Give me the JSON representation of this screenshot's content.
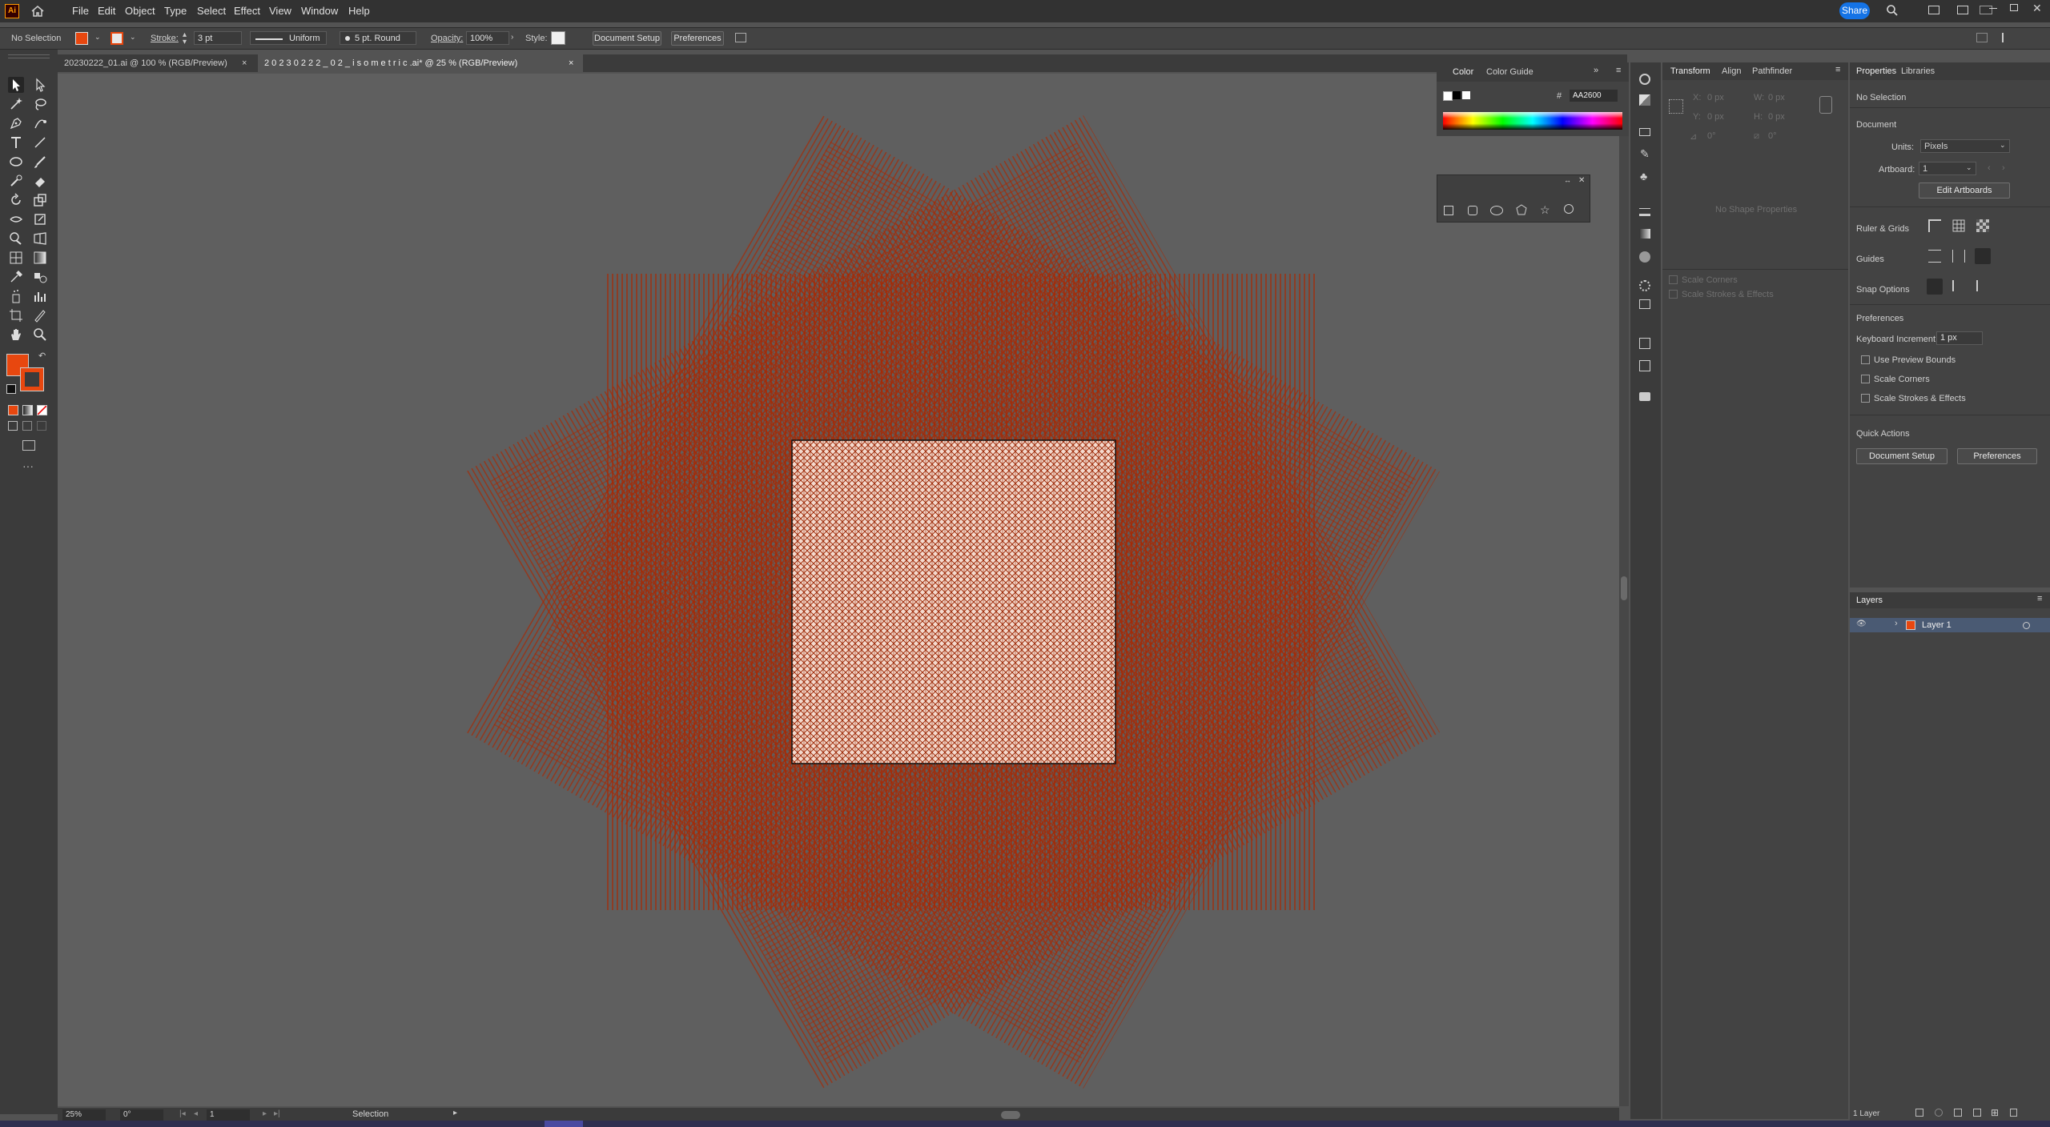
{
  "app": {
    "logo": "Ai",
    "brand_color": "#ff9a00",
    "accent": "#1473e6"
  },
  "menu": [
    "File",
    "Edit",
    "Object",
    "Type",
    "Select",
    "Effect",
    "View",
    "Window",
    "Help"
  ],
  "share_label": "Share",
  "control": {
    "selection": "No Selection",
    "fill_color": "#e8470f",
    "stroke_label": "Stroke:",
    "stroke_value": "3 pt",
    "profile": "Uniform",
    "brush": "5 pt. Round",
    "opacity_label": "Opacity:",
    "opacity_value": "100%",
    "style_label": "Style:",
    "doc_setup": "Document Setup",
    "preferences": "Preferences"
  },
  "tabs": [
    {
      "label": "20230222_01.ai @ 100 % (RGB/Preview)"
    },
    {
      "label": "2 0 2 3 0 2 2 2 _ 0 2 _ i s o m e t r i c .ai* @ 25 % (RGB/Preview)"
    }
  ],
  "artwork": {
    "line_color": "#aa2600",
    "pattern_bg": "#f3d8cb"
  },
  "color_panel": {
    "tab_color": "Color",
    "tab_guide": "Color Guide",
    "hash": "#",
    "hex": "AA2600"
  },
  "transform_panel": {
    "tabs": [
      "Transform",
      "Align",
      "Pathfinder"
    ],
    "x": "X:",
    "y": "Y:",
    "w": "W:",
    "h": "H:",
    "x_val": "0 px",
    "y_val": "0 px",
    "w_val": "0 px",
    "h_val": "0 px",
    "angle_val": "0°",
    "shear_val": "0°",
    "no_shape": "No Shape Properties",
    "scale_corners": "Scale Corners",
    "scale_strokes": "Scale Strokes & Effects"
  },
  "properties": {
    "tabs": [
      "Properties",
      "Libraries"
    ],
    "no_selection": "No Selection",
    "document": "Document",
    "units_label": "Units:",
    "units_value": "Pixels",
    "artboard_label": "Artboard:",
    "artboard_value": "1",
    "edit_artboards": "Edit Artboards",
    "rulers_grids": "Ruler & Grids",
    "guides": "Guides",
    "snap_options": "Snap Options",
    "preferences_heading": "Preferences",
    "keyboard_increment_label": "Keyboard Increment:",
    "keyboard_increment_value": "1 px",
    "use_preview_bounds": "Use Preview Bounds",
    "scale_corners": "Scale Corners",
    "scale_strokes": "Scale Strokes & Effects",
    "quick_actions": "Quick Actions",
    "doc_setup": "Document Setup",
    "preferences_btn": "Preferences"
  },
  "layers": {
    "title": "Layers",
    "layer_name": "Layer 1",
    "count": "1 Layer",
    "layer_color": "#e8470f"
  },
  "status": {
    "zoom": "25%",
    "rotation": "0°",
    "artboard": "1",
    "tool": "Selection"
  }
}
